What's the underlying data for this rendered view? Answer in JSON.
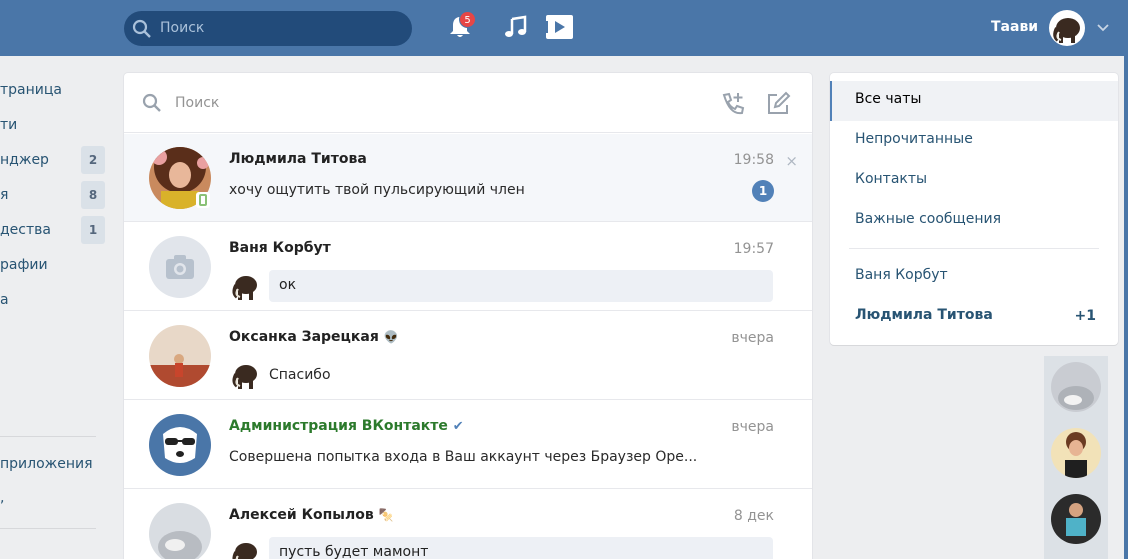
{
  "header": {
    "search_placeholder": "Поиск",
    "notifications_count": "5",
    "user_name": "Таави",
    "brand_color": "#4a76a8"
  },
  "left_nav": {
    "items": [
      {
        "label": "траница",
        "count": ""
      },
      {
        "label": "ти",
        "count": ""
      },
      {
        "label": "нджер",
        "count": "2"
      },
      {
        "label": "я",
        "count": "8"
      },
      {
        "label": "дества",
        "count": "1"
      },
      {
        "label": "рафии",
        "count": ""
      },
      {
        "label": "а",
        "count": ""
      }
    ],
    "apps_label": "приложения"
  },
  "messenger": {
    "search_placeholder": "Поиск",
    "dialogs": [
      {
        "name": "Людмила Титова",
        "time": "19:58",
        "text": "хочу ощутить твой пульсирующий член",
        "unread": "1",
        "close": "×"
      },
      {
        "name": "Ваня Корбут",
        "time": "19:57",
        "text": "ок"
      },
      {
        "name": "Оксанка Зарецкая",
        "emoji": "👽",
        "time": "вчера",
        "text": "Спасибо"
      },
      {
        "name": "Администрация ВКонтакте",
        "verified": "✔",
        "time": "вчера",
        "text": "Совершена попытка входа в Ваш аккаунт через Браузер Ope..."
      },
      {
        "name": "Алексей Копылов",
        "emoji": "🍢",
        "time": "8 дек",
        "text": "пусть будет мамонт"
      }
    ]
  },
  "right_menu": {
    "items": [
      {
        "label": "Все чаты"
      },
      {
        "label": "Непрочитанные"
      },
      {
        "label": "Контакты"
      },
      {
        "label": "Важные сообщения"
      }
    ],
    "recent": [
      {
        "label": "Ваня Корбут",
        "badge": ""
      },
      {
        "label": "Людмила Титова",
        "badge": "+1"
      }
    ]
  }
}
